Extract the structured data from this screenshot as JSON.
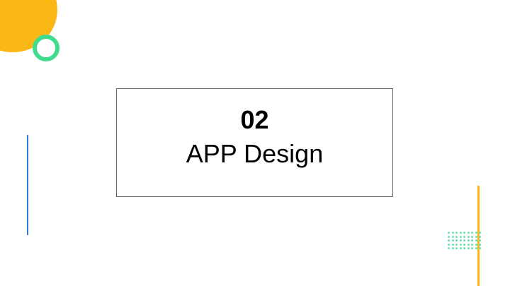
{
  "slide": {
    "section_number": "02",
    "section_title": "APP Design"
  },
  "colors": {
    "accent_yellow": "#FBB713",
    "accent_green": "#3FDB8F",
    "accent_blue": "#2F7BD6",
    "dot_green": "#6FE0B0",
    "text": "#000000",
    "box_border": "#666666"
  }
}
